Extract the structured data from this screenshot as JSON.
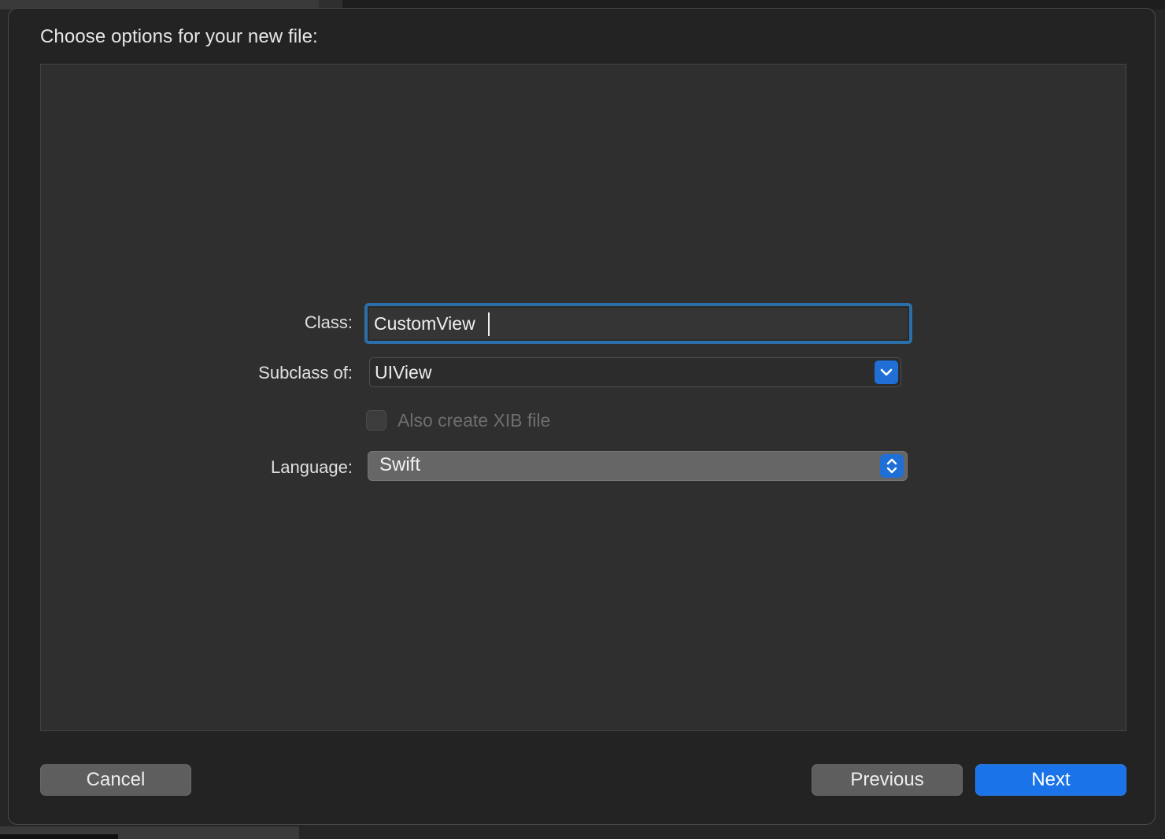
{
  "sheet": {
    "title": "Choose options for your new file:"
  },
  "form": {
    "class_label": "Class:",
    "class_value": "CustomView",
    "subclass_label": "Subclass of:",
    "subclass_value": "UIView",
    "xib_label": "Also create XIB file",
    "xib_checked": false,
    "language_label": "Language:",
    "language_value": "Swift"
  },
  "buttons": {
    "cancel": "Cancel",
    "previous": "Previous",
    "next": "Next"
  },
  "colors": {
    "accent": "#1a73e8",
    "focus_ring": "#2c6fa8"
  }
}
